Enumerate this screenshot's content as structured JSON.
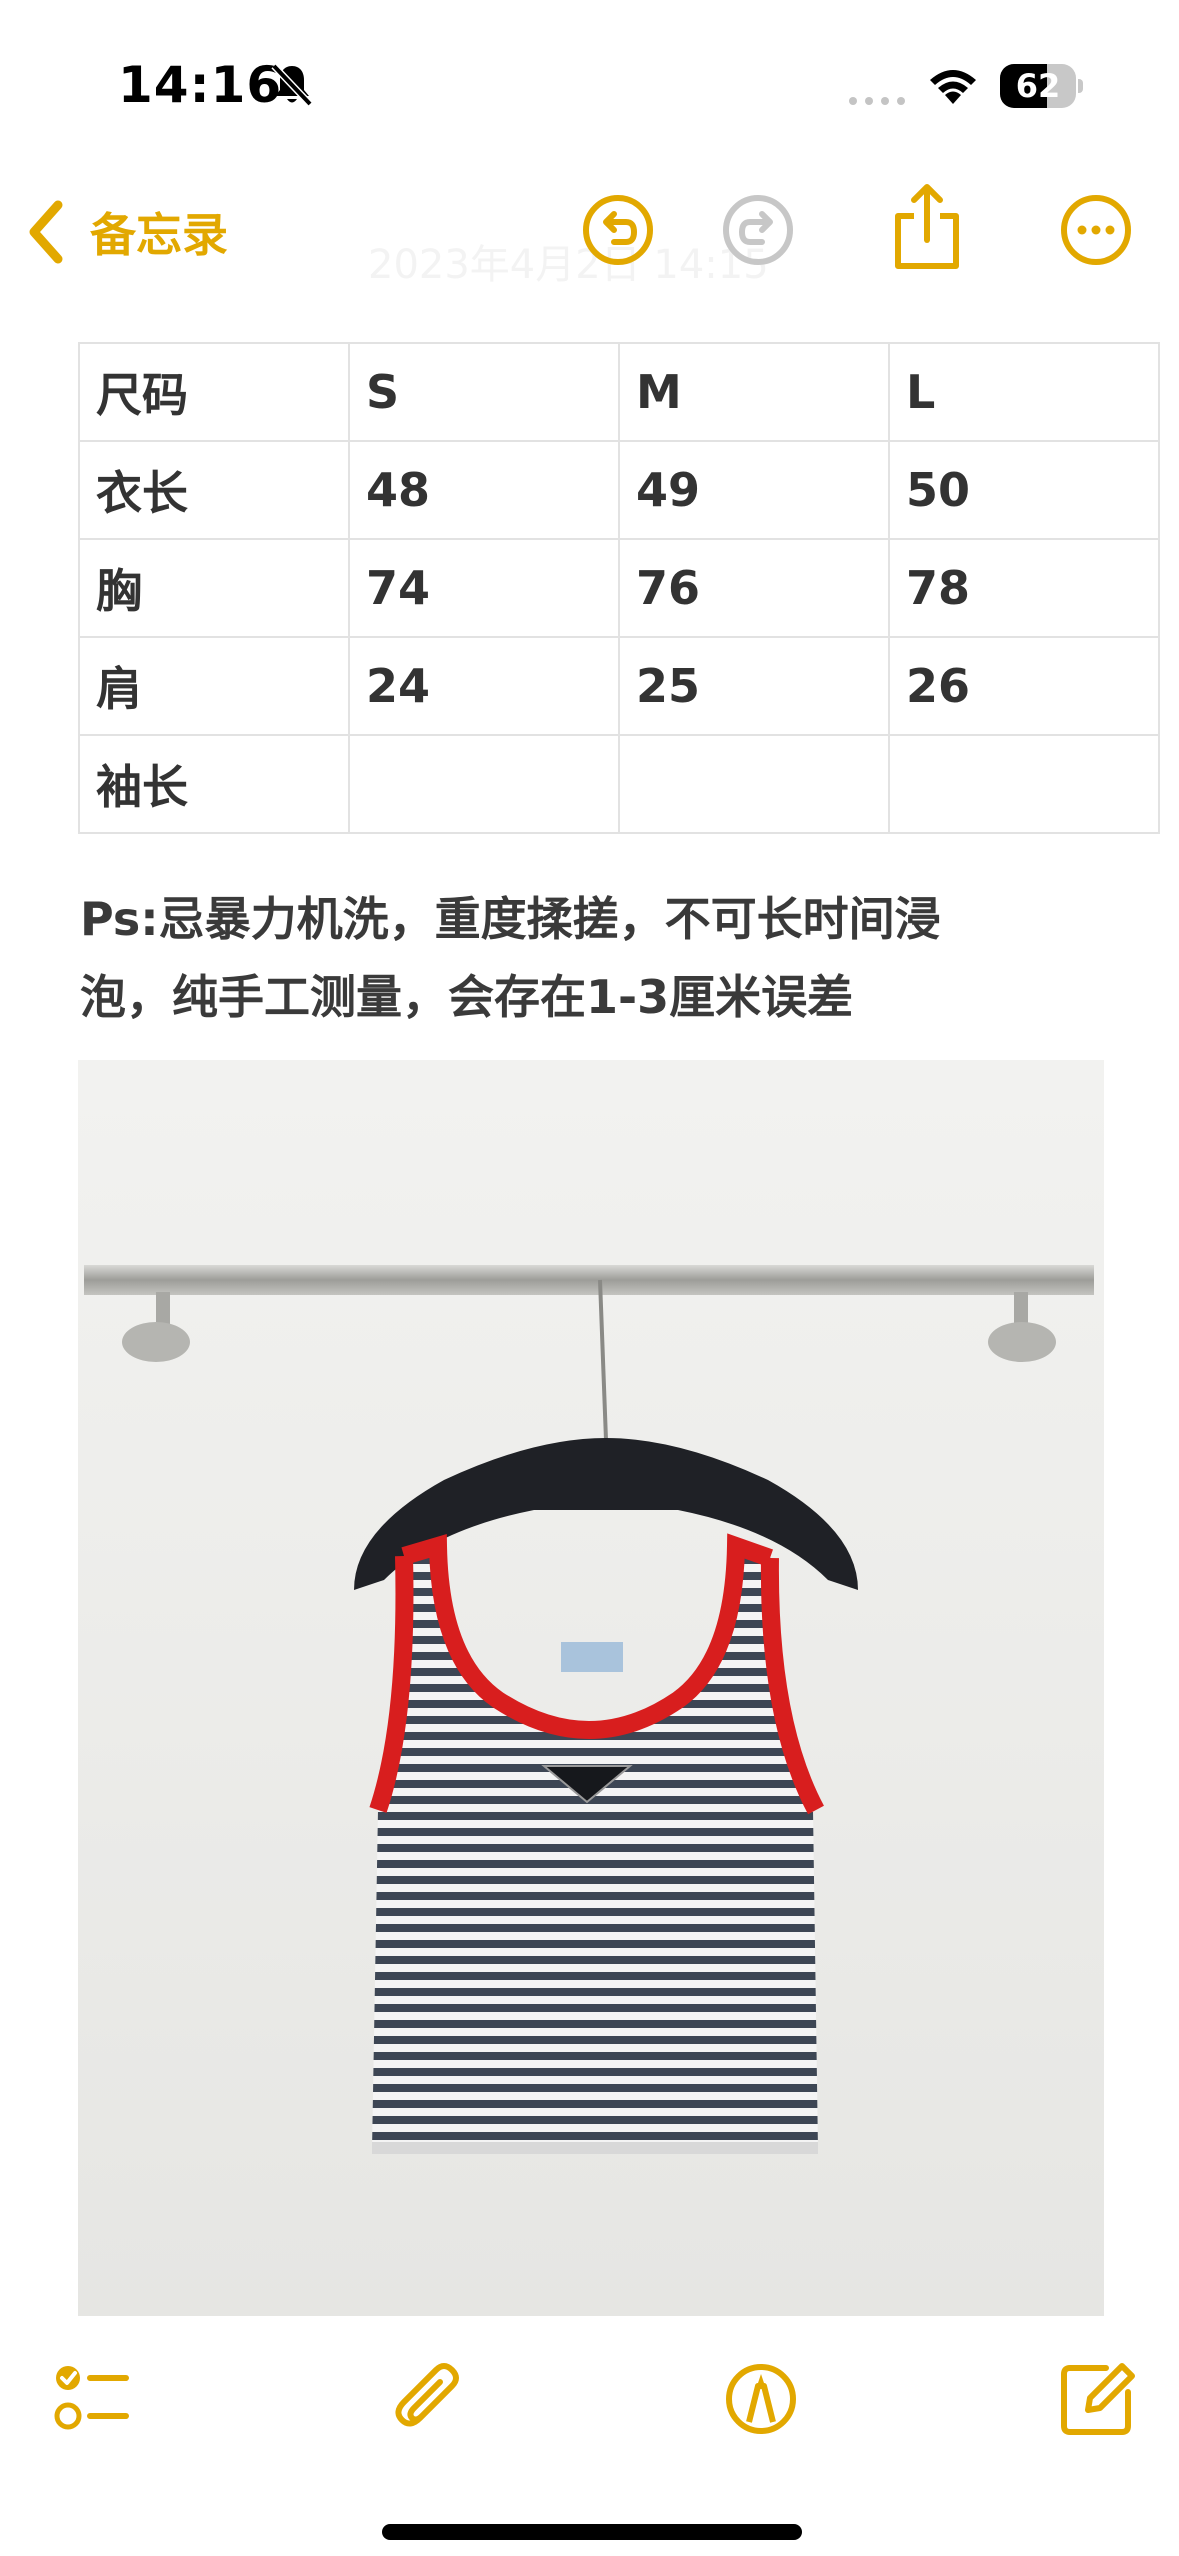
{
  "status_bar": {
    "time": "14:16",
    "battery_level": 62,
    "battery_text": "62",
    "icons": [
      "bell-slash-icon",
      "signal-dots-icon",
      "wifi-icon",
      "battery-icon"
    ]
  },
  "nav": {
    "back_label": "备忘录",
    "faded_date": "2023年4月2日 14:15",
    "icons": [
      "chevron-left-icon",
      "undo-icon",
      "redo-icon",
      "share-icon",
      "more-icon"
    ]
  },
  "accent_color": "#e2a800",
  "table": {
    "rows": [
      [
        "尺码",
        "S",
        "M",
        "L"
      ],
      [
        "衣长",
        "48",
        "49",
        "50"
      ],
      [
        "胸",
        "74",
        "76",
        "78"
      ],
      [
        "肩",
        "24",
        "25",
        "26"
      ],
      [
        "袖长",
        "",
        "",
        ""
      ]
    ]
  },
  "note": {
    "line1": "Ps:忌暴力机洗，重度揉搓，不可长时间浸",
    "line2": "泡，纯手工测量，会存在1-3厘米误差"
  },
  "photo": {
    "subject": "striped tank top with red trim on hanger"
  },
  "toolbar": {
    "icons": [
      "checklist-icon",
      "paperclip-icon",
      "markup-pen-icon",
      "compose-icon"
    ]
  }
}
